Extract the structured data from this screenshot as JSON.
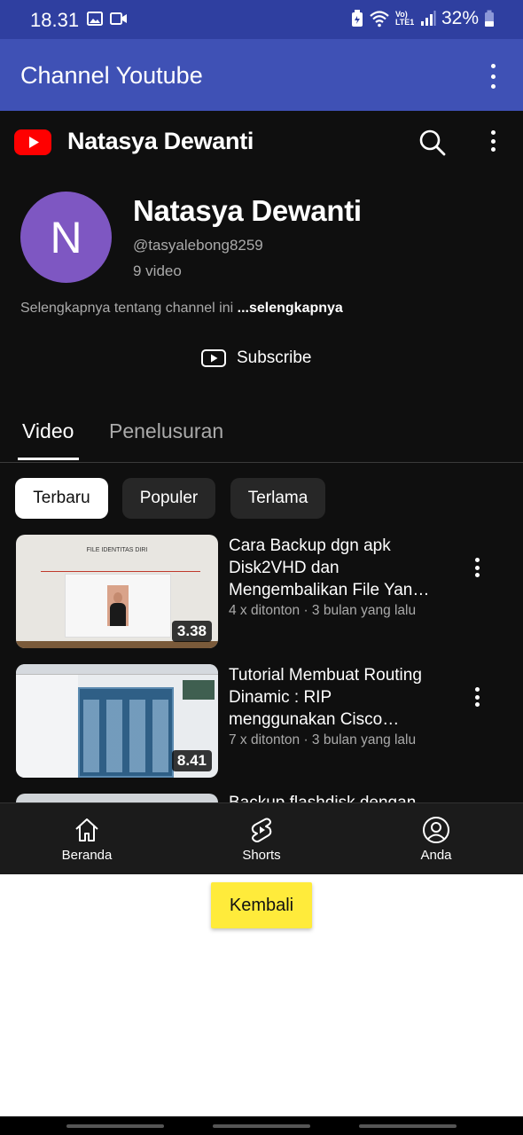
{
  "status_bar": {
    "time": "18.31",
    "network": "Vo) LTE1",
    "battery": "32%"
  },
  "app_bar": {
    "title": "Channel Youtube"
  },
  "yt_header": {
    "channel_title": "Natasya Dewanti"
  },
  "channel": {
    "avatar_letter": "N",
    "avatar_color": "#7e57c2",
    "name": "Natasya Dewanti",
    "handle": "@tasyalebong8259",
    "video_count": "9 video",
    "about_text": "Selengkapnya tentang channel ini",
    "about_link": "...selengkapnya",
    "subscribe_label": "Subscribe"
  },
  "tabs": [
    {
      "label": "Video",
      "active": true
    },
    {
      "label": "Penelusuran",
      "active": false
    }
  ],
  "chips": [
    {
      "label": "Terbaru",
      "active": true
    },
    {
      "label": "Populer",
      "active": false
    },
    {
      "label": "Terlama",
      "active": false
    }
  ],
  "videos": [
    {
      "title": "Cara Backup dgn apk Disk2VHD dan Mengembalikan File Yan…",
      "meta": "4 x ditonton · 3 bulan yang lalu",
      "duration": "3.38",
      "thumb_text": "FILE IDENTITAS DIRI"
    },
    {
      "title": "Tutorial Membuat Routing Dinamic : RIP menggunakan Cisco…",
      "meta": "7 x ditonton · 3 bulan yang lalu",
      "duration": "8.41"
    },
    {
      "title": "Backup flashdisk dengan"
    }
  ],
  "bottom_nav": [
    {
      "label": "Beranda",
      "icon": "home-icon"
    },
    {
      "label": "Shorts",
      "icon": "shorts-icon"
    },
    {
      "label": "Anda",
      "icon": "account-icon"
    }
  ],
  "back_button": {
    "label": "Kembali",
    "color": "#ffeb3b"
  },
  "colors": {
    "status_bar": "#2f3fa0",
    "app_bar": "#3f51b5",
    "yt_background": "#0f0f0f",
    "yt_red": "#ff0000"
  }
}
